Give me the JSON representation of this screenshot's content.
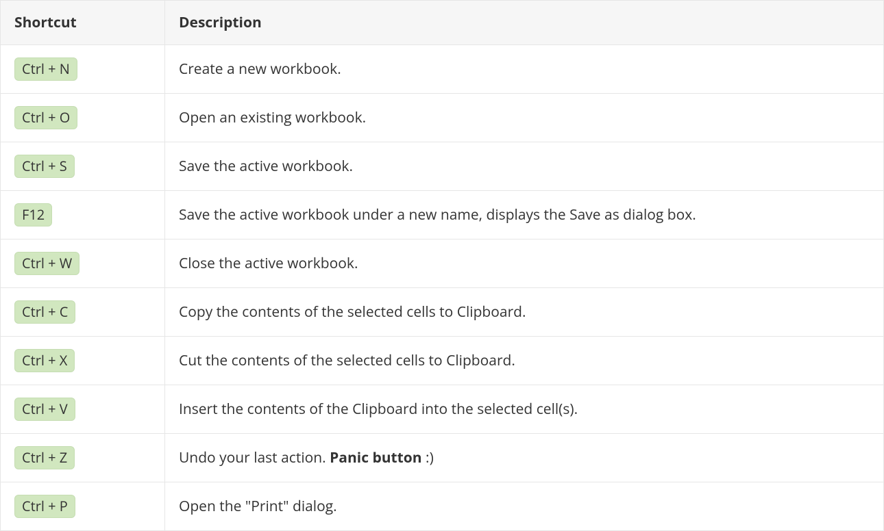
{
  "table": {
    "headers": {
      "shortcut": "Shortcut",
      "description": "Description"
    },
    "rows": [
      {
        "key": "Ctrl + N",
        "desc_pre": "Create a new workbook.",
        "desc_bold": "",
        "desc_post": ""
      },
      {
        "key": "Ctrl + O",
        "desc_pre": "Open an existing workbook.",
        "desc_bold": "",
        "desc_post": ""
      },
      {
        "key": "Ctrl + S",
        "desc_pre": "Save the active workbook.",
        "desc_bold": "",
        "desc_post": ""
      },
      {
        "key": "F12",
        "desc_pre": "Save the active workbook under a new name, displays the Save as dialog box.",
        "desc_bold": "",
        "desc_post": ""
      },
      {
        "key": "Ctrl + W",
        "desc_pre": "Close the active workbook.",
        "desc_bold": "",
        "desc_post": ""
      },
      {
        "key": "Ctrl + C",
        "desc_pre": "Copy the contents of the selected cells to Clipboard.",
        "desc_bold": "",
        "desc_post": ""
      },
      {
        "key": "Ctrl + X",
        "desc_pre": "Cut the contents of the selected cells to Clipboard.",
        "desc_bold": "",
        "desc_post": ""
      },
      {
        "key": "Ctrl + V",
        "desc_pre": "Insert the contents of the Clipboard into the selected cell(s).",
        "desc_bold": "",
        "desc_post": ""
      },
      {
        "key": "Ctrl + Z",
        "desc_pre": "Undo your last action. ",
        "desc_bold": "Panic button",
        "desc_post": " :)"
      },
      {
        "key": "Ctrl + P",
        "desc_pre": "Open the \"Print\" dialog.",
        "desc_bold": "",
        "desc_post": ""
      }
    ]
  }
}
